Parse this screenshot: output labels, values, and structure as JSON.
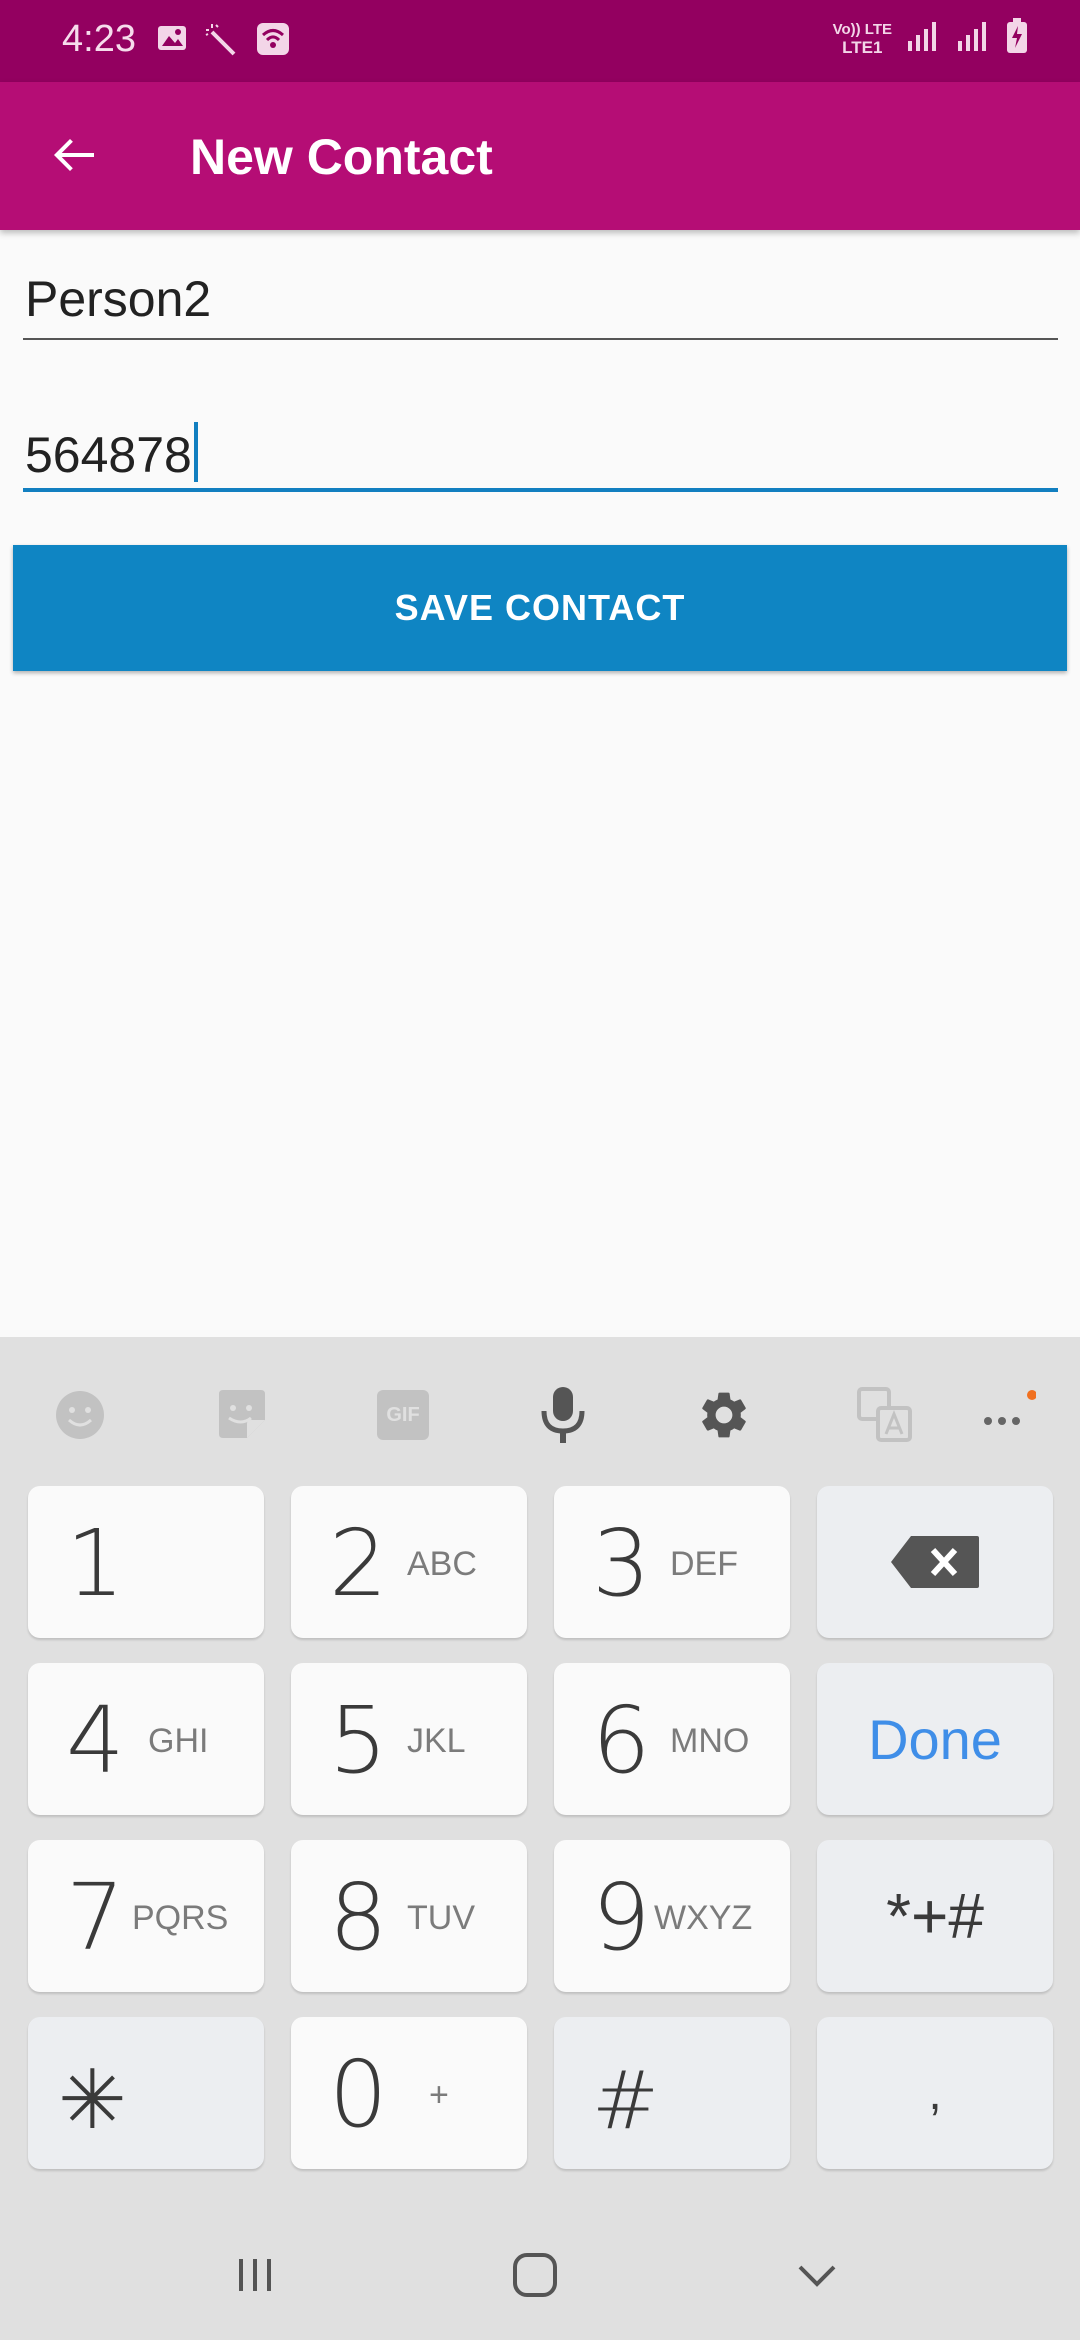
{
  "status_bar": {
    "time": "4:23",
    "network_top": "Vo)) LTE",
    "network_bottom": "LTE1",
    "lte_label": "LTE",
    "background": "#930060"
  },
  "app_bar": {
    "title": "New Contact",
    "background": "#b50d75"
  },
  "form": {
    "name_value": "Person2",
    "phone_value": "564878",
    "save_label": "SAVE CONTACT",
    "accent_color": "#0f85c3"
  },
  "keyboard": {
    "toolbar_icons": [
      "emoji-icon",
      "sticker-icon",
      "gif-icon",
      "microphone-icon",
      "settings-gear-icon",
      "translate-icon",
      "more-icon"
    ],
    "gif_label": "GIF",
    "keys": {
      "k1": {
        "num": "1",
        "letters": ""
      },
      "k2": {
        "num": "2",
        "letters": "ABC"
      },
      "k3": {
        "num": "3",
        "letters": "DEF"
      },
      "k4": {
        "num": "4",
        "letters": "GHI"
      },
      "k5": {
        "num": "5",
        "letters": "JKL"
      },
      "k6": {
        "num": "6",
        "letters": "MNO"
      },
      "k7": {
        "num": "7",
        "letters": "PQRS"
      },
      "k8": {
        "num": "8",
        "letters": "TUV"
      },
      "k9": {
        "num": "9",
        "letters": "WXYZ"
      },
      "k0": {
        "num": "0",
        "letters": "+"
      },
      "star": "✳",
      "hash": "#",
      "symbols": "*+#",
      "done": "Done",
      "comma": ","
    }
  }
}
